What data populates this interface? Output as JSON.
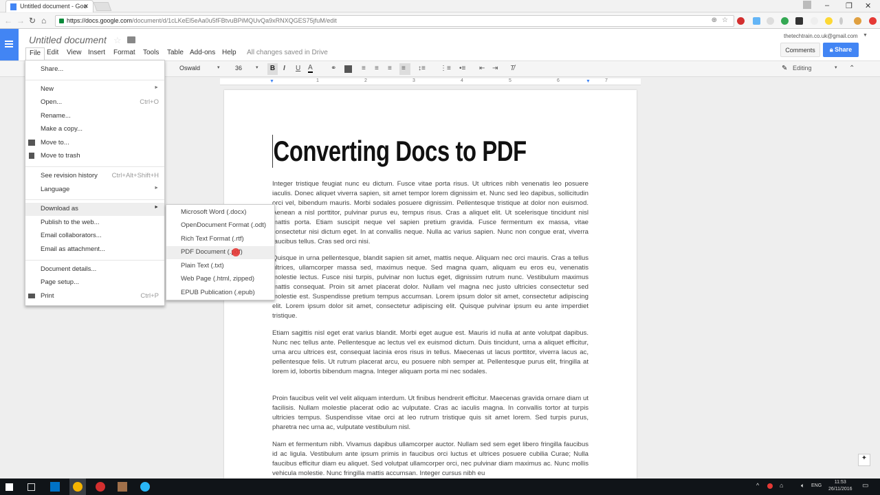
{
  "browser": {
    "tab_title": "Untitled document - Goo",
    "url_host": "https://docs.google.com",
    "url_path": "/document/d/1cLKeEl5eAa0u5fFBtvuBPiMQUvQa9xRNXQGES75jfuM/edit"
  },
  "docs": {
    "title": "Untitled document",
    "menu": [
      "File",
      "Edit",
      "View",
      "Insert",
      "Format",
      "Tools",
      "Table",
      "Add-ons",
      "Help"
    ],
    "saved_status": "All changes saved in Drive",
    "account": "thetechtrain.co.uk@gmail.com",
    "comments_label": "Comments",
    "share_label": "Share"
  },
  "toolbar": {
    "font": "Oswald",
    "size": "36",
    "bold": "B",
    "italic": "I",
    "underline": "U",
    "text_color": "A",
    "mode": "Editing"
  },
  "ruler": [
    "1",
    "2",
    "3",
    "4",
    "5",
    "6",
    "7"
  ],
  "file_menu": {
    "share": "Share...",
    "new": "New",
    "open": "Open...",
    "open_sc": "Ctrl+O",
    "rename": "Rename...",
    "copy": "Make a copy...",
    "move": "Move to...",
    "trash": "Move to trash",
    "revision": "See revision history",
    "revision_sc": "Ctrl+Alt+Shift+H",
    "language": "Language",
    "download": "Download as",
    "publish": "Publish to the web...",
    "email_collab": "Email collaborators...",
    "email_attach": "Email as attachment...",
    "details": "Document details...",
    "page_setup": "Page setup...",
    "print": "Print",
    "print_sc": "Ctrl+P"
  },
  "download_submenu": [
    "Microsoft Word (.docx)",
    "OpenDocument Format (.odt)",
    "Rich Text Format (.rtf)",
    "PDF Document (.pdf)",
    "Plain Text (.txt)",
    "Web Page (.html, zipped)",
    "EPUB Publication (.epub)"
  ],
  "document": {
    "heading": "Converting Docs to PDF",
    "paragraphs": [
      "Integer tristique feugiat nunc eu dictum. Fusce vitae porta risus. Ut ultrices nibh venenatis leo posuere iaculis. Donec aliquet viverra sapien, sit amet tempor lorem dignissim et. Nunc sed leo dapibus, sollicitudin orci vel, bibendum mauris. Morbi sodales posuere dignissim. Pellentesque tristique at dolor non euismod. Aenean a nisl porttitor, pulvinar purus eu, tempus risus. Cras a aliquet elit. Ut scelerisque tincidunt nisl mattis porta. Etiam suscipit neque vel sapien pretium gravida. Fusce fermentum ex massa, vitae consectetur nisi dictum eget. In at convallis neque. Nulla ac varius sapien. Nunc non congue erat, viverra faucibus tellus. Cras sed orci nisi.",
      "Quisque in urna pellentesque, blandit sapien sit amet, mattis neque. Aliquam nec orci mauris. Cras a tellus ultrices, ullamcorper massa sed, maximus neque. Sed magna quam, aliquam eu eros eu, venenatis molestie lectus. Fusce nisi turpis, pulvinar non luctus eget, dignissim rutrum nunc. Vestibulum maximus mattis consequat. Proin sit amet placerat dolor. Nullam vel magna nec justo ultricies consectetur sed molestie est. Suspendisse pretium tempus accumsan. Lorem ipsum dolor sit amet, consectetur adipiscing elit. Lorem ipsum dolor sit amet, consectetur adipiscing elit. Quisque pulvinar ipsum eu ante imperdiet tristique.",
      "Etiam sagittis nisl eget erat varius blandit. Morbi eget augue est. Mauris id nulla at ante volutpat dapibus. Nunc nec tellus ante. Pellentesque ac lectus vel ex euismod dictum. Duis tincidunt, urna a aliquet efficitur, urna arcu ultrices est, consequat lacinia eros risus in tellus. Maecenas ut lacus porttitor, viverra lacus ac, pellentesque felis. Ut rutrum placerat arcu, eu posuere nibh semper at. Pellentesque purus elit, fringilla at lorem id, lobortis bibendum magna. Integer aliquam porta mi nec sodales.",
      "Proin faucibus velit vel velit aliquam interdum. Ut finibus hendrerit efficitur. Maecenas gravida ornare diam ut facilisis. Nullam molestie placerat odio ac vulputate. Cras ac iaculis magna. In convallis tortor at turpis ultricies tempus. Suspendisse vitae orci at leo rutrum tristique quis sit amet lorem. Sed turpis purus, pharetra nec urna ac, vulputate vestibulum nisl.",
      "Nam et fermentum nibh. Vivamus dapibus ullamcorper auctor. Nullam sed sem eget libero fringilla faucibus id ac ligula. Vestibulum ante ipsum primis in faucibus orci luctus et ultrices posuere cubilia Curae; Nulla faucibus efficitur diam eu aliquet. Sed volutpat ullamcorper orci, nec pulvinar diam maximus ac. Nunc mollis vehicula molestie. Nunc fringilla mattis accumsan. Integer cursus nibh eu"
    ]
  },
  "taskbar": {
    "language": "ENG",
    "time": "11:53",
    "date": "26/11/2016"
  },
  "colors": {
    "accent": "#4285f4",
    "cursor": "#e53935"
  }
}
